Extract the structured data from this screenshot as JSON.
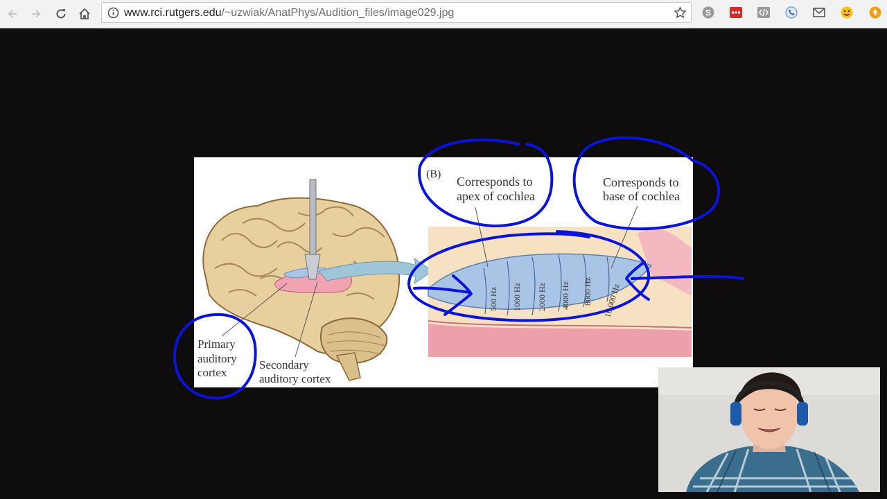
{
  "browser": {
    "url_host": "www.rci.rutgers.edu",
    "url_path": "/~uzwiak/AnatPhys/Audition_files/image029.jpg"
  },
  "figure": {
    "panel_label": "(B)",
    "apex_label_1": "Corresponds to",
    "apex_label_2": "apex of cochlea",
    "base_label_1": "Corresponds to",
    "base_label_2": "base of cochlea",
    "primary_1": "Primary",
    "primary_2": "auditory",
    "primary_3": "cortex",
    "secondary_1": "Secondary",
    "secondary_2": "auditory cortex",
    "frequencies": [
      "500 Hz",
      "1000 Hz",
      "2000 Hz",
      "4000 Hz",
      "8000 Hz",
      "16,000 Hz"
    ]
  },
  "colors": {
    "annotation": "#0a14d8",
    "cortex_blue": "#a9c4e4",
    "cortex_pink": "#f2a3b2",
    "brain": "#e8cf9e"
  }
}
